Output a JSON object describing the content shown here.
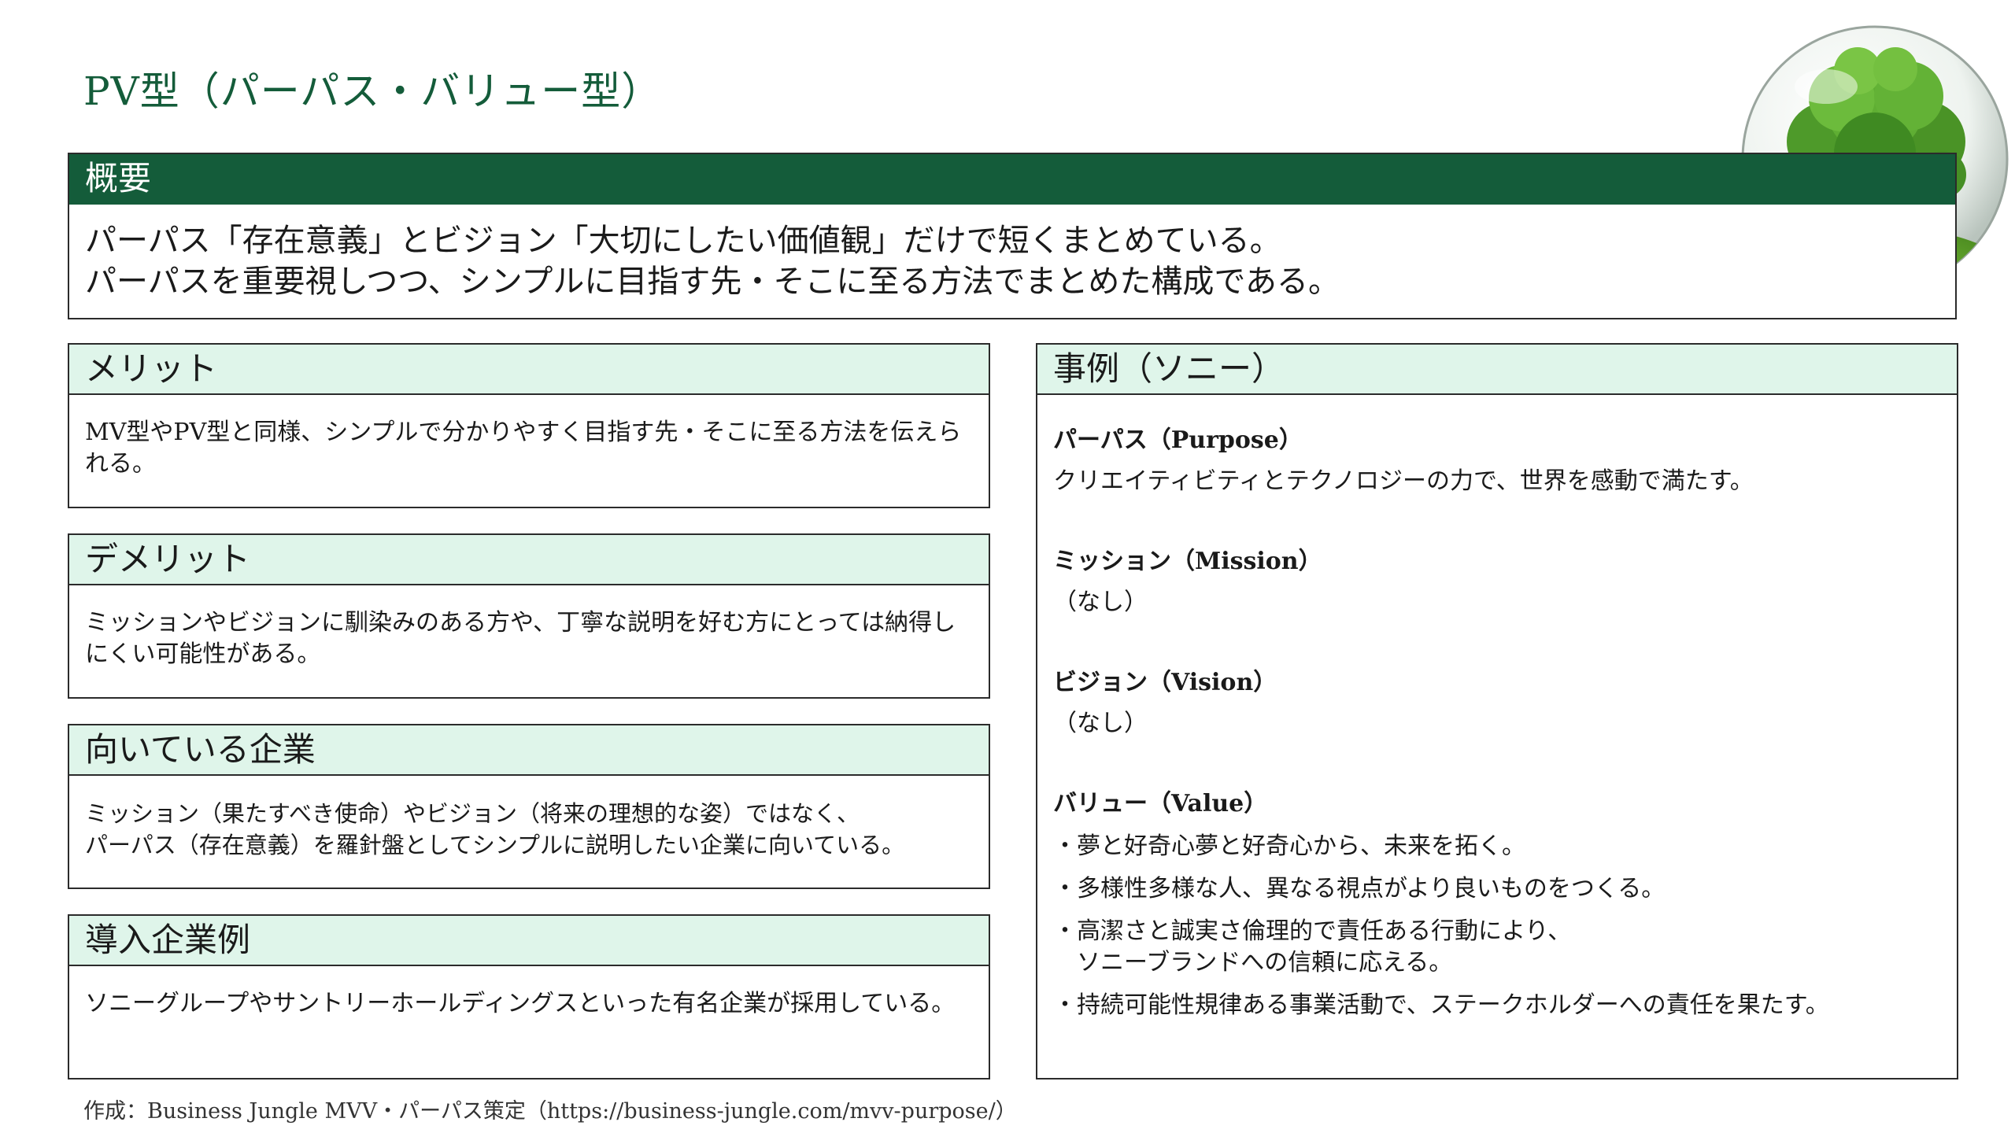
{
  "title": "PV型（パーパス・バリュー型）",
  "overview": {
    "heading": "概要",
    "line1": "パーパス「存在意義」とビジョン「大切にしたい価値観」だけで短くまとめている。",
    "line2": "パーパスを重要視しつつ、シンプルに目指す先・そこに至る方法でまとめた構成である。"
  },
  "merit": {
    "heading": "メリット",
    "text": "MV型やPV型と同様、シンプルで分かりやすく目指す先・そこに至る方法を伝えられる。"
  },
  "demerit": {
    "heading": "デメリット",
    "text": "ミッションやビジョンに馴染みのある方や、丁寧な説明を好む方にとっては納得しにくい可能性がある。"
  },
  "suitable": {
    "heading": "向いている企業",
    "line1": "ミッション（果たすべき使命）やビジョン（将来の理想的な姿）ではなく、",
    "line2": "パーパス（存在意義）を羅針盤としてシンプルに説明したい企業に向いている。"
  },
  "adopters": {
    "heading": "導入企業例",
    "text": "ソニーグループやサントリーホールディングスといった有名企業が採用している。"
  },
  "example": {
    "heading": "事例（ソニー）",
    "purpose_label": "パーパス（Purpose）",
    "purpose_text": "クリエイティビティとテクノロジーの力で、世界を感動で満たす。",
    "mission_label": "ミッション（Mission）",
    "mission_text": "（なし）",
    "vision_label": "ビジョン（Vision）",
    "vision_text": "（なし）",
    "value_label": "バリュー（Value）",
    "values": [
      "・夢と好奇心夢と好奇心から、未来を拓く。",
      "・多様性多様な人、異なる視点がより良いものをつくる。",
      "・高潔さと誠実さ倫理的で責任ある行動により、",
      "ソニーブランドへの信頼に応える。",
      "・持続可能性規律ある事業活動で、ステークホルダーへの責任を果たす。"
    ]
  },
  "footer": "作成：Business Jungle MVV・パーパス策定（https://business-jungle.com/mvv-purpose/）",
  "colors": {
    "brand": "#145c3a",
    "header_bg": "#dff5ea"
  }
}
